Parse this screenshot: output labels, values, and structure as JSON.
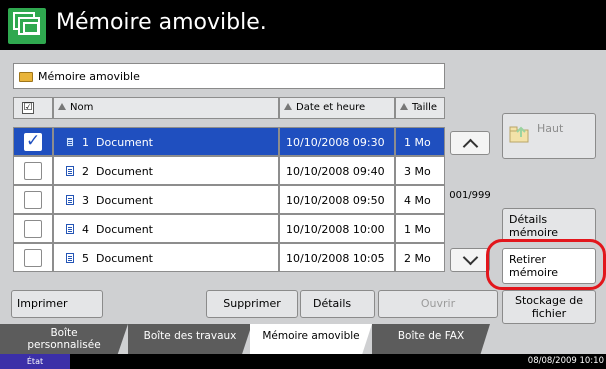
{
  "title": "Mémoire amovible.",
  "path": "Mémoire amovible",
  "table": {
    "headers": {
      "name": "Nom",
      "date": "Date et heure",
      "size": "Taille"
    },
    "rows": [
      {
        "num": "1",
        "name": "Document",
        "date": "10/10/2008 09:30",
        "size": "1 Mo",
        "selected": true
      },
      {
        "num": "2",
        "name": "Document",
        "date": "10/10/2008 09:40",
        "size": "3 Mo",
        "selected": false
      },
      {
        "num": "3",
        "name": "Document",
        "date": "10/10/2008 09:50",
        "size": "4 Mo",
        "selected": false
      },
      {
        "num": "4",
        "name": "Document",
        "date": "10/10/2008 10:00",
        "size": "1 Mo",
        "selected": false
      },
      {
        "num": "5",
        "name": "Document",
        "date": "10/10/2008 10:05",
        "size": "2 Mo",
        "selected": false
      }
    ]
  },
  "page_counter": "001/999",
  "right_buttons": {
    "haut": "Haut",
    "details_memoire": [
      "Détails",
      "mémoire"
    ],
    "retirer_memoire": [
      "Retirer",
      "mémoire"
    ],
    "stockage_fichier": [
      "Stockage de",
      "fichier"
    ]
  },
  "actions": {
    "imprimer": "Imprimer",
    "supprimer": "Supprimer",
    "details": "Détails",
    "ouvrir": "Ouvrir"
  },
  "tabs": [
    {
      "label": [
        "Boîte",
        "personnalisée"
      ],
      "active": false
    },
    {
      "label": [
        "Boîte des travaux"
      ],
      "active": false
    },
    {
      "label": [
        "Mémoire amovible"
      ],
      "active": true
    },
    {
      "label": [
        "Boîte de FAX"
      ],
      "active": false
    }
  ],
  "status": {
    "label": "État",
    "datetime": "08/08/2009   10:10"
  },
  "colors": {
    "selection": "#1f4fbf",
    "highlight_ring": "#e2161c",
    "title_icon": "#2fa84f"
  }
}
